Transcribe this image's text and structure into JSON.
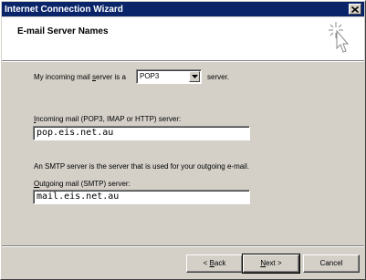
{
  "window": {
    "title": "Internet Connection Wizard"
  },
  "header": {
    "title": "E-mail Server Names"
  },
  "incoming_type": {
    "prefix_pre": "My incoming mail ",
    "prefix_u": "s",
    "prefix_post": "erver is a",
    "selected": "POP3",
    "suffix": "server."
  },
  "incoming": {
    "label_u": "I",
    "label_rest": "ncoming mail (POP3, IMAP or HTTP) server:",
    "value": "pop.eis.net.au"
  },
  "smtp_note": "An SMTP server is the server that is used for your outgoing e-mail.",
  "outgoing": {
    "label_u": "O",
    "label_rest": "utgoing mail (SMTP) server:",
    "value": "mail.eis.net.au"
  },
  "buttons": {
    "back_arrow": "< ",
    "back_u": "B",
    "back_rest": "ack",
    "next_u": "N",
    "next_rest": "ext >",
    "cancel": "Cancel"
  }
}
